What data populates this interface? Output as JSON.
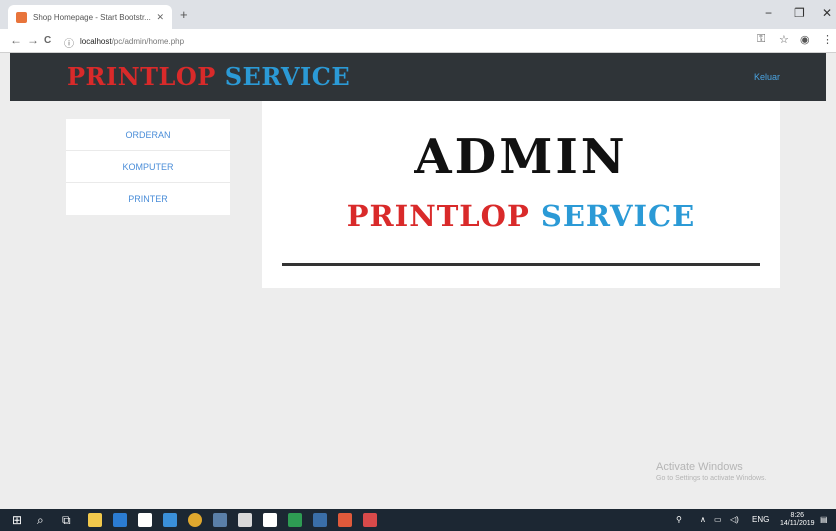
{
  "browser": {
    "tab_title": "Shop Homepage - Start Bootstr...",
    "tab_close": "✕",
    "new_tab": "+",
    "window_controls": [
      "−",
      "❐",
      "✕"
    ],
    "url_host": "localhost",
    "url_path": "/pc/admin/home.php",
    "nav": {
      "back": "←",
      "forward": "→",
      "reload": "C",
      "info": "ⓘ"
    }
  },
  "site": {
    "brand_part1": "PRINTLOP",
    "brand_part2": "SERVICE",
    "logout_label": "Keluar"
  },
  "menu": [
    {
      "label": "ORDERAN"
    },
    {
      "label": "KOMPUTER"
    },
    {
      "label": "PRINTER"
    }
  ],
  "main": {
    "title": "ADMIN",
    "subtitle_part1": "PRINTLOP",
    "subtitle_part2": "SERVICE"
  },
  "watermark": {
    "line1": "Activate Windows",
    "line2": "Go to Settings to activate Windows."
  },
  "taskbar": {
    "time": "8:26",
    "date": "14/11/2019",
    "items": [
      {
        "icon": "windows-start-icon",
        "color": "#ffffff"
      },
      {
        "icon": "search-icon",
        "color": "#ffffff"
      },
      {
        "icon": "task-view-icon",
        "color": "#ffffff"
      },
      {
        "icon": "explorer-icon",
        "color": "#f2c94c"
      },
      {
        "icon": "edge-icon",
        "color": "#2b7cd3"
      },
      {
        "icon": "store-icon",
        "color": "#ffffff"
      },
      {
        "icon": "check-icon",
        "color": "#3a8fd9"
      },
      {
        "icon": "chrome-icon",
        "color": "#e0a82e"
      },
      {
        "icon": "calculator-icon",
        "color": "#5a7fa8"
      },
      {
        "icon": "feather-icon",
        "color": "#d9d9d9"
      },
      {
        "icon": "bag-icon",
        "color": "#ffffff"
      },
      {
        "icon": "phone-icon",
        "color": "#2e9b53"
      },
      {
        "icon": "settings-icon",
        "color": "#3a6ea8"
      },
      {
        "icon": "folder-icon",
        "color": "#e05a3b"
      },
      {
        "icon": "app-icon",
        "color": "#d94a4a"
      }
    ]
  },
  "colors": {
    "brand_red": "#d92a2a",
    "brand_blue": "#2b9ad6",
    "header_bg": "#2f3438"
  }
}
